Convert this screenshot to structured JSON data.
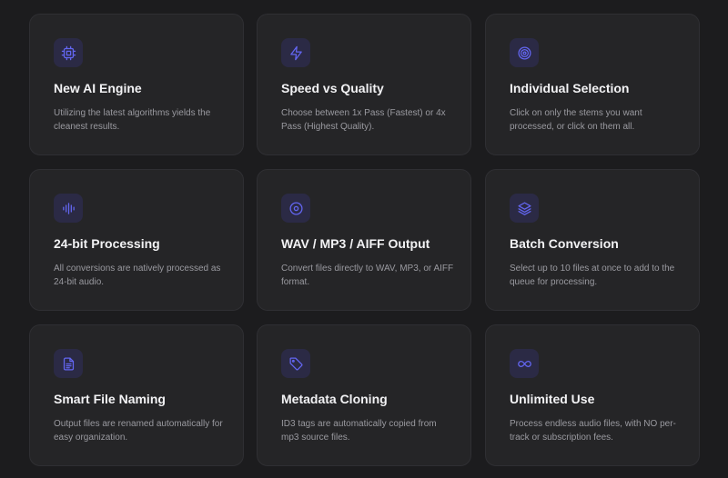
{
  "colors": {
    "background": "#1c1c1e",
    "card": "#252527",
    "card_border": "#2f2f33",
    "icon_bg": "#2b2a45",
    "accent": "#6366f1",
    "title": "#f2f2f4",
    "description": "#9a9aa0"
  },
  "features": [
    {
      "icon": "cpu-icon",
      "title": "New AI Engine",
      "description": "Utilizing the latest algorithms yields the cleanest results."
    },
    {
      "icon": "lightning-icon",
      "title": "Speed vs Quality",
      "description": "Choose between 1x Pass (Fastest) or 4x Pass (Highest Quality)."
    },
    {
      "icon": "target-icon",
      "title": "Individual Selection",
      "description": "Click on only the stems you want processed, or click on them all."
    },
    {
      "icon": "waveform-icon",
      "title": "24-bit Processing",
      "description": "All conversions are natively processed as 24-bit audio."
    },
    {
      "icon": "disc-icon",
      "title": "WAV / MP3 / AIFF Output",
      "description": "Convert files directly to WAV, MP3, or AIFF format."
    },
    {
      "icon": "layers-icon",
      "title": "Batch Conversion",
      "description": "Select up to 10 files at once to add to the queue for processing."
    },
    {
      "icon": "document-icon",
      "title": "Smart File Naming",
      "description": "Output files are renamed automatically for easy organization."
    },
    {
      "icon": "tag-icon",
      "title": "Metadata Cloning",
      "description": "ID3 tags are automatically copied from mp3 source files."
    },
    {
      "icon": "infinity-icon",
      "title": "Unlimited Use",
      "description": "Process endless audio files, with NO per-track or subscription fees."
    }
  ]
}
